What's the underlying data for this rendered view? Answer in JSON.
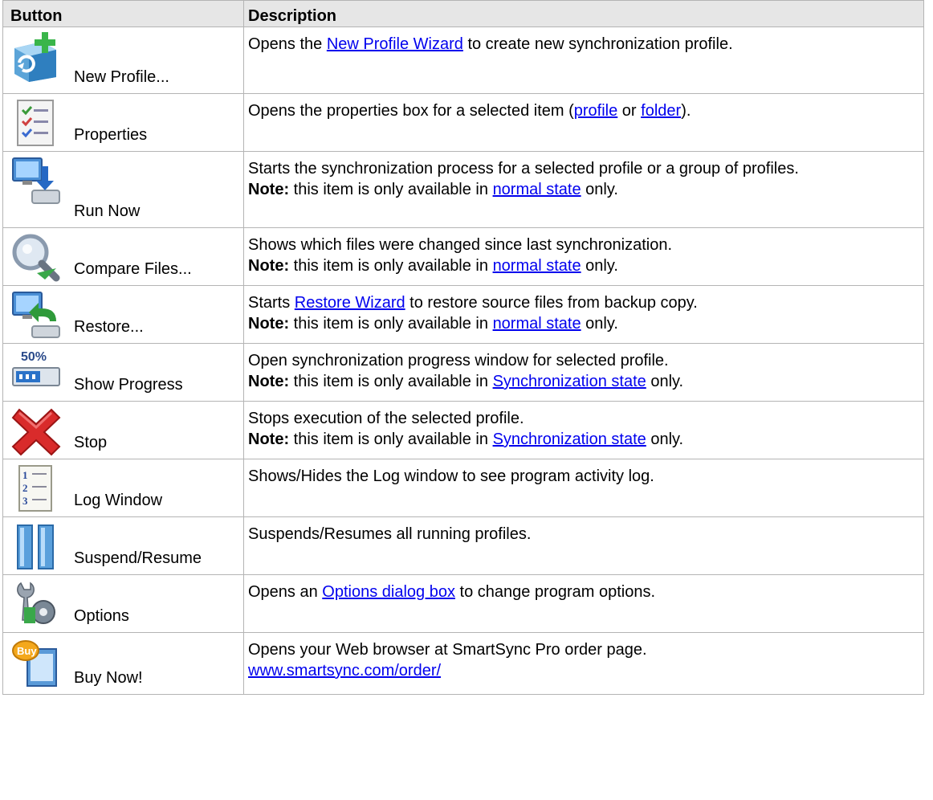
{
  "header": {
    "button": "Button",
    "description": "Description"
  },
  "rows": [
    {
      "label": "New Profile...",
      "icon": "new-profile-icon",
      "d1": "Opens the ",
      "link1": "New Profile Wizard",
      "d2": " to create new synchronization profile."
    },
    {
      "label": "Properties",
      "icon": "properties-icon",
      "d1": "Opens the properties box for a selected item (",
      "link1": "profile",
      "d2": " or ",
      "link2": "folder",
      "d3": ")."
    },
    {
      "label": "Run Now",
      "icon": "run-now-icon",
      "d1": "Starts the synchronization process for a selected profile or a group of profiles.",
      "note_label": "Note:",
      "note_text": " this item is only available in ",
      "note_link": "normal state",
      "note_end": " only."
    },
    {
      "label": "Compare Files...",
      "icon": "compare-files-icon",
      "d1": "Shows which files were changed since last synchronization.",
      "note_label": "Note:",
      "note_text": " this item is only available in ",
      "note_link": "normal state",
      "note_end": " only."
    },
    {
      "label": "Restore...",
      "icon": "restore-icon",
      "d1": "Starts ",
      "link1": "Restore Wizard",
      "d2": " to restore source files from backup copy.",
      "note_label": "Note:",
      "note_text": " this item is only available in ",
      "note_link": "normal state",
      "note_end": " only."
    },
    {
      "label": "Show Progress",
      "icon": "show-progress-icon",
      "icon_text": "50%",
      "d1": "Open synchronization progress window for selected profile.",
      "note_label": "Note:",
      "note_text": " this item is only available in ",
      "note_link": "Synchronization state",
      "note_end": " only."
    },
    {
      "label": "Stop",
      "icon": "stop-icon",
      "d1": "Stops execution of the selected profile.",
      "note_label": "Note:",
      "note_text": " this item is only available in ",
      "note_link": "Synchronization state",
      "note_end": " only."
    },
    {
      "label": "Log Window",
      "icon": "log-window-icon",
      "d1": "Shows/Hides the Log window to see program activity log."
    },
    {
      "label": "Suspend/Resume",
      "icon": "suspend-resume-icon",
      "d1": "Suspends/Resumes all running profiles."
    },
    {
      "label": "Options",
      "icon": "options-icon",
      "d1": "Opens an ",
      "link1": "Options dialog box",
      "d2": " to change program options."
    },
    {
      "label": "Buy Now!",
      "icon": "buy-now-icon",
      "icon_text": "Buy",
      "d1": "Opens your Web browser at SmartSync Pro order page.",
      "link1": "www.smartsync.com/order/"
    }
  ]
}
